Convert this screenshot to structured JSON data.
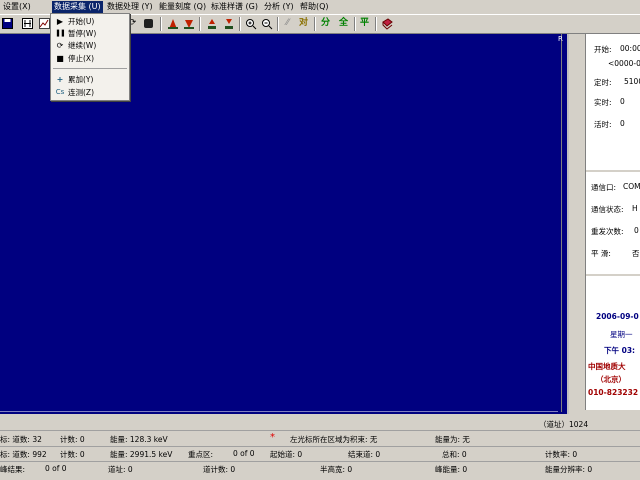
{
  "menubar": {
    "items": [
      {
        "label": "设置(X)",
        "active": false
      },
      {
        "label": "数据采集 (U)",
        "active": true
      },
      {
        "label": "数据处理 (Y)",
        "active": false
      },
      {
        "label": "能量刻度 (Q)",
        "active": false
      },
      {
        "label": "标准样谱 (G)",
        "active": false
      },
      {
        "label": "分析 (Y)",
        "active": false
      },
      {
        "label": "帮助(Q)",
        "active": false
      }
    ]
  },
  "dropdown": {
    "items": [
      {
        "label": "开始(U)",
        "icon": "play-icon"
      },
      {
        "label": "暂停(W)",
        "icon": "pause-icon"
      },
      {
        "label": "继续(W)",
        "icon": "resume-icon"
      },
      {
        "label": "停止(X)",
        "icon": "stop-icon"
      },
      {
        "label": "累加(Y)",
        "icon": "plus-icon"
      },
      {
        "label": "连测(Z)",
        "icon": "cs-icon"
      }
    ],
    "icon_glyphs": {
      "play": "▶",
      "pause": "❚❚",
      "resume": "⟳",
      "stop": "■",
      "plus": "+",
      "cs": "Cs"
    }
  },
  "toolbar": {
    "text_buttons": [
      "对",
      "分",
      "全",
      "平"
    ]
  },
  "plot": {
    "r_marker": "R",
    "background": "#000080"
  },
  "right_panel": {
    "start_label": "开始:",
    "start_value": "00:00",
    "start_range": "<0000-00",
    "timer_label": "定时:",
    "timer_value": "5100",
    "real_label": "实时:",
    "real_value": "0",
    "live_label": "活时:",
    "live_value": "0",
    "port_label": "通信口:",
    "port_value": "COM",
    "comm_label": "通信状态:",
    "comm_value": "H",
    "resend_label": "重发次数:",
    "resend_value": "0",
    "smooth_label": "平  滑:",
    "smooth_value": "否",
    "date": "2006-09-0",
    "weekday": "星期一",
    "time": "下午 03:",
    "org_line1": "中国地质大",
    "org_line2": "（北京）",
    "phone": "010-823232"
  },
  "status": {
    "addr_label": "（道址）1024",
    "row1": {
      "left_cursor": "标: 道数: 32",
      "count1": "计数: 0",
      "energy1": "能量: 128.3  keV",
      "asterisk": "*",
      "roi_label": "左光标所在区域为积束: 无",
      "energy_is": "能量为: 无"
    },
    "row2": {
      "right_cursor": "标: 道数: 992",
      "count2": "计数: 0",
      "energy2": "能量: 2991.5  keV",
      "key_region": "重点区:",
      "key_region_value": "0 of 0",
      "start_ch": "起始道: 0",
      "end_ch": "结束道: 0",
      "total": "总和: 0",
      "count_rate": "计数率: 0"
    },
    "row3": {
      "peak_result": "峰结果:",
      "peak_of": "0 of 0",
      "channel": "道址: 0",
      "peak_count": "道计数: 0",
      "fwhm": "半高宽: 0",
      "peak_energy": "峰能量: 0",
      "energy_res": "能量分辨率: 0"
    }
  }
}
